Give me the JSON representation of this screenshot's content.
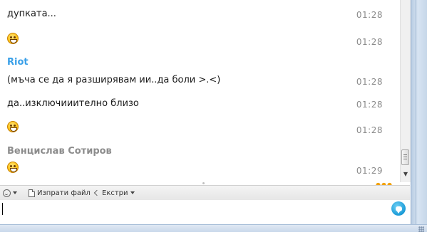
{
  "messages": [
    {
      "text": "дупката...",
      "time": "01:28"
    },
    {
      "emoji": "laughing-emoticon",
      "time": "01:28"
    },
    {
      "sender": "Riot",
      "sender_color": "#3aa0e8"
    },
    {
      "text": "(мъча се да я разширявам ии..да боли >.<)",
      "time": "01:28"
    },
    {
      "text": "да..изключииително близо",
      "time": "01:28"
    },
    {
      "emoji": "laughing-emoticon",
      "time": "01:28"
    },
    {
      "sender": "Венцислав Сотиров",
      "sender_color": "#8c8c8c"
    },
    {
      "emoji": "laughing-emoticon",
      "time": "01:29"
    }
  ],
  "toolbar": {
    "emoticon_icon": "smiley-icon",
    "send_file_label": "Изпрати файл",
    "extras_label": "Екстри"
  },
  "composer": {
    "value": "",
    "placeholder": "",
    "send_icon": "chat-bubble-icon"
  },
  "colors": {
    "accent": "#1a9bd7",
    "timestamp": "#8a8a8a",
    "typing_indicator": "#f2a100"
  }
}
